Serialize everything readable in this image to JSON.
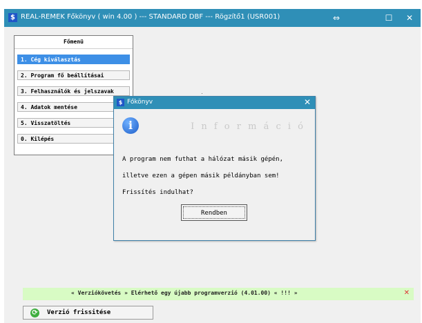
{
  "window": {
    "icon": "dollar-app-icon",
    "title": "REAL-REMEK Főkönyv  ( win 4.00 )  ---  STANDARD DBF  ---  Rögzítő1 (USR001)",
    "controls": {
      "restore": "⇔",
      "maximize": "☐",
      "close": "✕"
    }
  },
  "main_menu": {
    "header": "Főmenü",
    "items": [
      "1.  Cég kiválasztás",
      "2.  Program fő beállításai",
      "3.  Felhasználók és jelszavak",
      "4.  Adatok mentése",
      "5.  Visszatöltés",
      "0.  Kilépés"
    ],
    "selected_index": 0
  },
  "dialog": {
    "title": "Főkönyv",
    "close_label": "✕",
    "icon": "info-icon",
    "header": "I n f o r m á c i ó",
    "lines": [
      "A program nem futhat a hálózat másik gépén,",
      "illetve ezen a gépen másik példányban sem!",
      "Frissítés indulhat?"
    ],
    "ok_label": "Rendben"
  },
  "notice": {
    "text": "« Verziókövetés »  Elérhető egy újabb programverzió (4.01.00)  « !!! »",
    "close_label": "✕"
  },
  "update_button": {
    "icon": "refresh-icon",
    "label": "Verzió frissitése"
  },
  "colors": {
    "titlebar": "#2f8fb7",
    "selected_item": "#3d8fe6",
    "notice_bg": "#d8fbc4"
  }
}
